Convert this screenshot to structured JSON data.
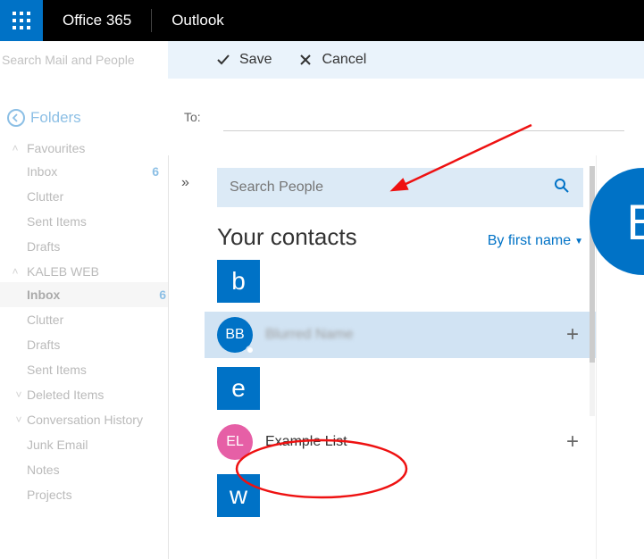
{
  "header": {
    "brand": "Office 365",
    "app": "Outlook"
  },
  "search": {
    "placeholder": "Search Mail and People"
  },
  "toolbar": {
    "save": "Save",
    "cancel": "Cancel"
  },
  "compose": {
    "to_label": "To:"
  },
  "nav": {
    "folders_label": "Folders",
    "groups": [
      {
        "name": "Favourites",
        "type": "chev-up",
        "items": [
          {
            "name": "Inbox",
            "count": "6"
          },
          {
            "name": "Clutter"
          },
          {
            "name": "Sent Items"
          },
          {
            "name": "Drafts"
          }
        ]
      },
      {
        "name": "KALEB WEB",
        "type": "chev-up",
        "items": [
          {
            "name": "Inbox",
            "count": "6",
            "active": true
          },
          {
            "name": "Clutter"
          },
          {
            "name": "Drafts"
          },
          {
            "name": "Sent Items"
          },
          {
            "name": "Deleted Items",
            "chev": true
          },
          {
            "name": "Conversation History",
            "chev": true
          },
          {
            "name": "Junk Email"
          },
          {
            "name": "Notes"
          },
          {
            "name": "Projects"
          }
        ]
      }
    ]
  },
  "people": {
    "expand_glyph": "»",
    "search_placeholder": "Search People",
    "title": "Your contacts",
    "sort_label": "By first name",
    "sections": [
      {
        "letter": "b",
        "contacts": [
          {
            "initials": "BB",
            "name": "Blurred Name",
            "color": "blue",
            "highlight": true,
            "blur": true,
            "plus": true,
            "presence": true
          }
        ]
      },
      {
        "letter": "e",
        "contacts": [
          {
            "initials": "EL",
            "name": "Example List",
            "color": "pink",
            "plus": true
          }
        ]
      },
      {
        "letter": "w",
        "contacts": []
      }
    ]
  },
  "preview": {
    "initial": "B"
  }
}
